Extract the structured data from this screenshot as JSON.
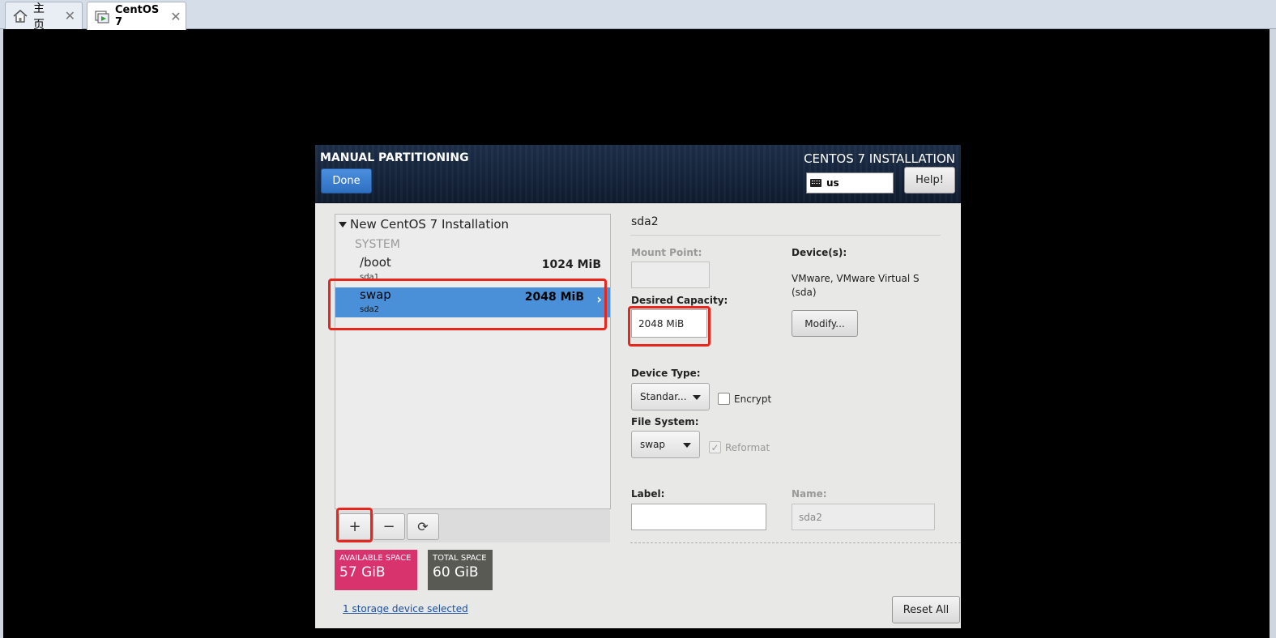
{
  "tabs": [
    {
      "label": "主页",
      "icon": "home-icon",
      "active": false
    },
    {
      "label": "CentOS 7",
      "icon": "vm-icon",
      "active": true
    }
  ],
  "header": {
    "title": "MANUAL PARTITIONING",
    "product": "CENTOS 7 INSTALLATION",
    "done_label": "Done",
    "keyboard_layout": "us",
    "help_label": "Help!"
  },
  "tree": {
    "root_label": "New CentOS 7 Installation",
    "group_label": "SYSTEM",
    "partitions": [
      {
        "name": "/boot",
        "device": "sda1",
        "size": "1024 MiB",
        "selected": false
      },
      {
        "name": "swap",
        "device": "sda2",
        "size": "2048 MiB",
        "selected": true
      }
    ],
    "toolbar": {
      "add": "+",
      "remove": "−",
      "refresh": "⟳"
    }
  },
  "space": {
    "available_label": "AVAILABLE SPACE",
    "available_value": "57 GiB",
    "available_color": "#d8336d",
    "total_label": "TOTAL SPACE",
    "total_value": "60 GiB",
    "total_color": "#5a5a55"
  },
  "storage_link": "1 storage device selected",
  "reset_label": "Reset All",
  "details": {
    "title": "sda2",
    "mount_point_label": "Mount Point:",
    "mount_point_value": "",
    "desired_capacity_label": "Desired Capacity:",
    "desired_capacity_value": "2048 MiB",
    "devices_label": "Device(s):",
    "devices_value": "VMware, VMware Virtual S (sda)",
    "modify_label": "Modify...",
    "device_type_label": "Device Type:",
    "device_type_value": "Standar...",
    "encrypt_label": "Encrypt",
    "file_system_label": "File System:",
    "file_system_value": "swap",
    "reformat_label": "Reformat",
    "label_label": "Label:",
    "label_value": "",
    "name_label": "Name:",
    "name_value": "sda2"
  },
  "colors": {
    "highlight": "#e8261c",
    "selection": "#4a90d9",
    "accent_button": "#2f6fc1"
  }
}
